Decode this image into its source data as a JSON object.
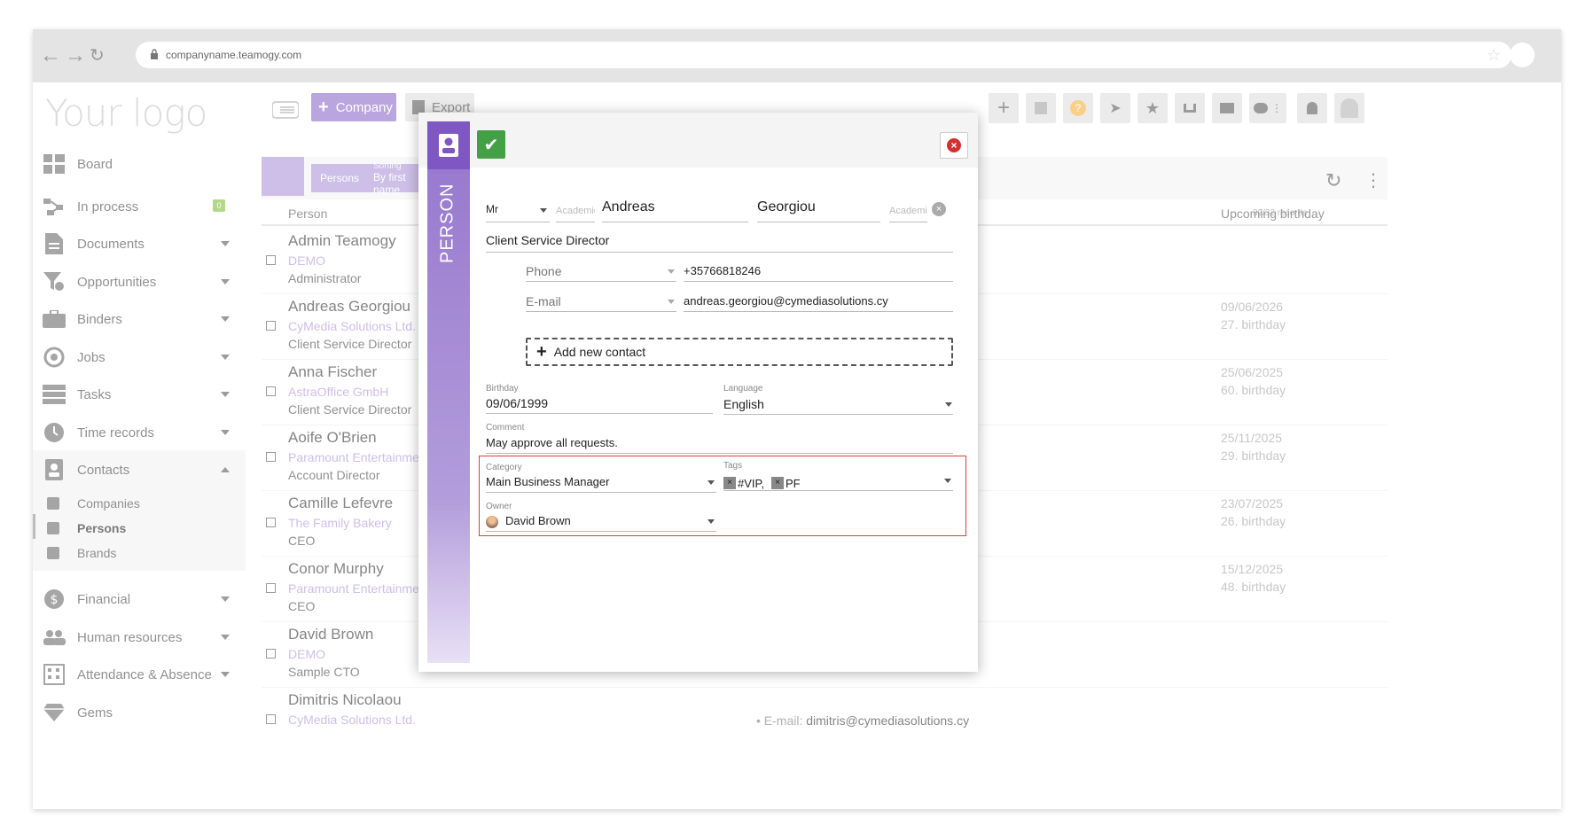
{
  "browser": {
    "url": "companyname.teamogy.com"
  },
  "logo": "Your logo",
  "toolbar": {
    "company_label": "Company",
    "export_label": "Export"
  },
  "sidebar": {
    "items": [
      {
        "label": "Board"
      },
      {
        "label": "In process",
        "badge": "0"
      },
      {
        "label": "Documents"
      },
      {
        "label": "Opportunities"
      },
      {
        "label": "Binders"
      },
      {
        "label": "Jobs"
      },
      {
        "label": "Tasks"
      },
      {
        "label": "Time records"
      },
      {
        "label": "Contacts"
      },
      {
        "label": "Financial"
      },
      {
        "label": "Human resources"
      },
      {
        "label": "Attendance & Absence"
      },
      {
        "label": "Gems"
      }
    ],
    "contacts_sub": [
      "Companies",
      "Persons",
      "Brands"
    ]
  },
  "list": {
    "crumb_persons": "Persons",
    "crumb_sorting": "Sorting",
    "crumb_sort_value": "By first name",
    "records": "32/32 records",
    "col_person": "Person",
    "col_birthday": "Upcoming birthday",
    "rows": [
      {
        "name": "Admin Teamogy",
        "company": "DEMO",
        "title": "Administrator",
        "bday_date": "",
        "bday_age": ""
      },
      {
        "name": "Andreas Georgiou",
        "company": "CyMedia Solutions Ltd.",
        "title": "Client Service Director",
        "bday_date": "09/06/2026",
        "bday_age": "27. birthday"
      },
      {
        "name": "Anna Fischer",
        "company": "AstraOffice GmbH",
        "title": "Client Service Director",
        "bday_date": "25/06/2025",
        "bday_age": "60. birthday"
      },
      {
        "name": "Aoife O'Brien",
        "company": "Paramount Entertainment LTD",
        "title": "Account Director",
        "bday_date": "25/11/2025",
        "bday_age": "29. birthday"
      },
      {
        "name": "Camille Lefevre",
        "company": "The Family Bakery",
        "title": "CEO",
        "bday_date": "23/07/2025",
        "bday_age": "26. birthday"
      },
      {
        "name": "Conor Murphy",
        "company": "Paramount Entertainment LTD",
        "title": "CEO",
        "bday_date": "15/12/2025",
        "bday_age": "48. birthday"
      },
      {
        "name": "David Brown",
        "company": "DEMO",
        "title": "Sample CTO",
        "bday_date": "",
        "bday_age": ""
      },
      {
        "name": "Dimitris Nicolaou",
        "company": "CyMedia Solutions Ltd.",
        "title": "",
        "bday_date": "",
        "bday_age": ""
      }
    ],
    "extra_email_label": "E-mail:",
    "extra_email_value": "dimitris@cymediasolutions.cy"
  },
  "modal": {
    "side_label": "PERSON",
    "salutation": "Mr",
    "academic_before_ph": "Academic...",
    "first_name": "Andreas",
    "last_name": "Georgiou",
    "academic_after_ph": "Academic...",
    "position": "Client Service Director",
    "phone_type": "Phone",
    "phone_value": "+35766818246",
    "email_type": "E-mail",
    "email_value": "andreas.georgiou@cymediasolutions.cy",
    "add_contact": "Add new contact",
    "birthday_label": "Birthday",
    "birthday_value": "09/06/1999",
    "language_label": "Language",
    "language_value": "English",
    "comment_label": "Comment",
    "comment_value": "May approve all requests.",
    "category_label": "Category",
    "category_value": "Main Business Manager",
    "tags_label": "Tags",
    "tags": [
      "#VIP,",
      "PF"
    ],
    "owner_label": "Owner",
    "owner_value": "David Brown"
  }
}
